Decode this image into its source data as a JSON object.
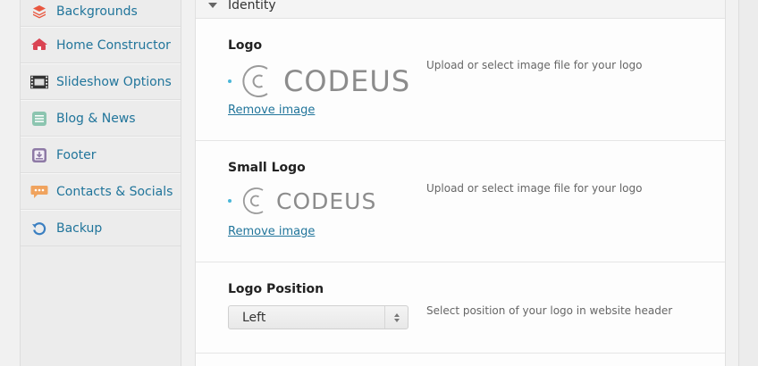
{
  "sidebar": {
    "items": [
      {
        "label": "Backgrounds",
        "icon": "layers-icon",
        "color": "#e9573f"
      },
      {
        "label": "Home Constructor",
        "icon": "house-icon",
        "color": "#da4453"
      },
      {
        "label": "Slideshow Options",
        "icon": "film-icon",
        "color": "#333333"
      },
      {
        "label": "Blog & News",
        "icon": "document-icon",
        "color": "#8cc5b0"
      },
      {
        "label": "Footer",
        "icon": "download-box-icon",
        "color": "#8e7aa6"
      },
      {
        "label": "Contacts & Socials",
        "icon": "speech-bubble-icon",
        "color": "#f0a35e"
      },
      {
        "label": "Backup",
        "icon": "refresh-icon",
        "color": "#3a7fc1"
      }
    ]
  },
  "section": {
    "title": "Identity"
  },
  "fields": {
    "logo": {
      "label": "Logo",
      "logo_text": "CODEUS",
      "remove_label": "Remove image",
      "description": "Upload or select image file for your logo"
    },
    "small_logo": {
      "label": "Small Logo",
      "logo_text": "CODEUS",
      "remove_label": "Remove image",
      "description": "Upload or select image file for your logo"
    },
    "logo_position": {
      "label": "Logo Position",
      "selected": "Left",
      "description": "Select position of your logo in website header"
    }
  },
  "colors": {
    "link": "#21759b",
    "accent_dot": "#4ab6d8"
  }
}
